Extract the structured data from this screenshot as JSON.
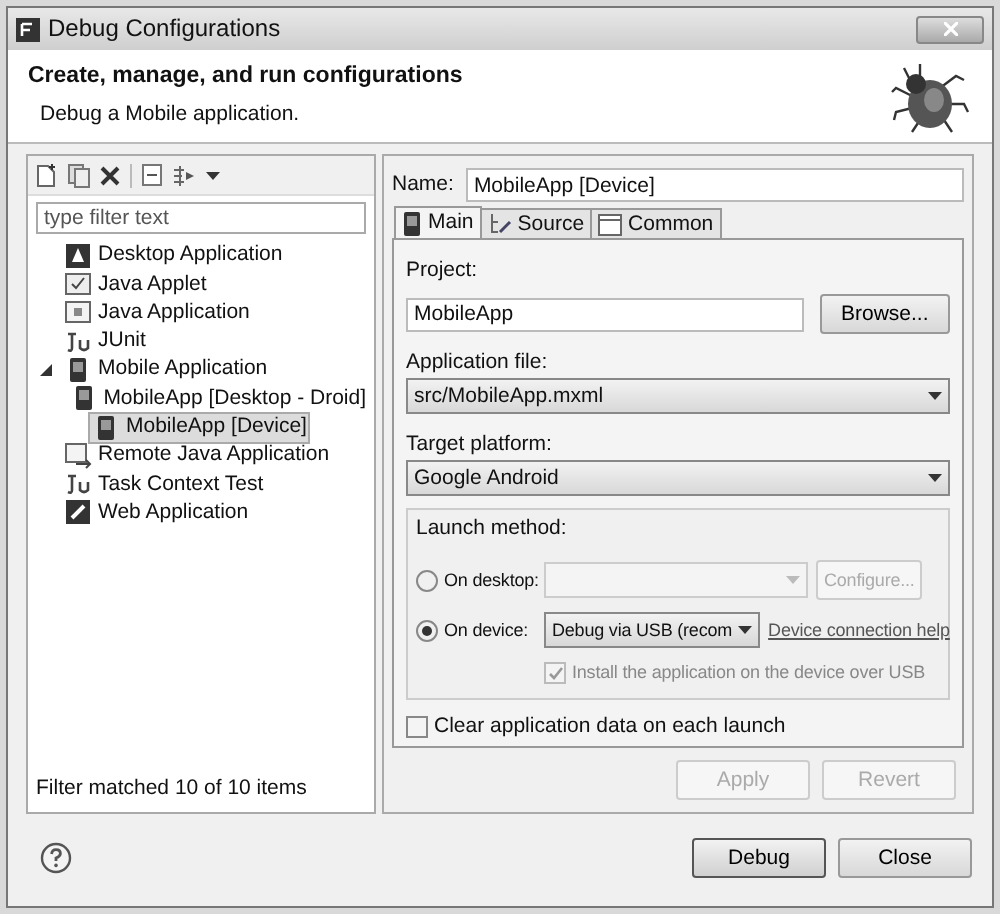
{
  "window": {
    "title": "Debug Configurations"
  },
  "header": {
    "title": "Create, manage, and run configurations",
    "subtitle": "Debug a Mobile application."
  },
  "filter": {
    "placeholder": "type filter text"
  },
  "tree": [
    {
      "label": "Desktop Application",
      "kind": "desktop",
      "selected": false
    },
    {
      "label": "Java Applet",
      "kind": "applet",
      "selected": false
    },
    {
      "label": "Java Application",
      "kind": "java",
      "selected": false
    },
    {
      "label": "JUnit",
      "kind": "junit",
      "selected": false
    },
    {
      "label": "Mobile Application",
      "kind": "mobile",
      "selected": false,
      "expanded": true,
      "children": [
        {
          "label": "MobileApp [Desktop - Droid]",
          "kind": "mobile",
          "selected": false
        },
        {
          "label": "MobileApp [Device]",
          "kind": "mobile",
          "selected": true
        }
      ]
    },
    {
      "label": "Remote Java Application",
      "kind": "remote",
      "selected": false
    },
    {
      "label": "Task Context Test",
      "kind": "junit",
      "selected": false
    },
    {
      "label": "Web Application",
      "kind": "web",
      "selected": false
    }
  ],
  "filter_status": "Filter matched 10 of 10 items",
  "name": {
    "label": "Name:",
    "value": "MobileApp [Device]"
  },
  "tabs": [
    {
      "label": "Main",
      "kind": "main",
      "selected": true
    },
    {
      "label": "Source",
      "kind": "source",
      "selected": false
    },
    {
      "label": "Common",
      "kind": "common",
      "selected": false
    }
  ],
  "project": {
    "label": "Project:",
    "value": "MobileApp",
    "button": "Browse..."
  },
  "application_file": {
    "label": "Application file:",
    "value": "src/MobileApp.mxml"
  },
  "target_platform": {
    "label": "Target platform:",
    "value": "Google Android"
  },
  "launch_method": {
    "legend": "Launch method:",
    "desktop": {
      "label": "On desktop:",
      "selected": false,
      "button": "Configure...",
      "disabled": true
    },
    "device": {
      "label": "On device:",
      "selected": true,
      "value": "Debug via USB (recom",
      "link": "Device connection help"
    },
    "install": {
      "label": "Install the application on the device over USB",
      "checked": true,
      "disabled": true
    }
  },
  "clear_data": {
    "label": "Clear application data on each launch",
    "checked": false
  },
  "apply": {
    "label": "Apply",
    "disabled": true
  },
  "revert": {
    "label": "Revert",
    "disabled": true
  },
  "debug_button": "Debug",
  "close_button": "Close"
}
